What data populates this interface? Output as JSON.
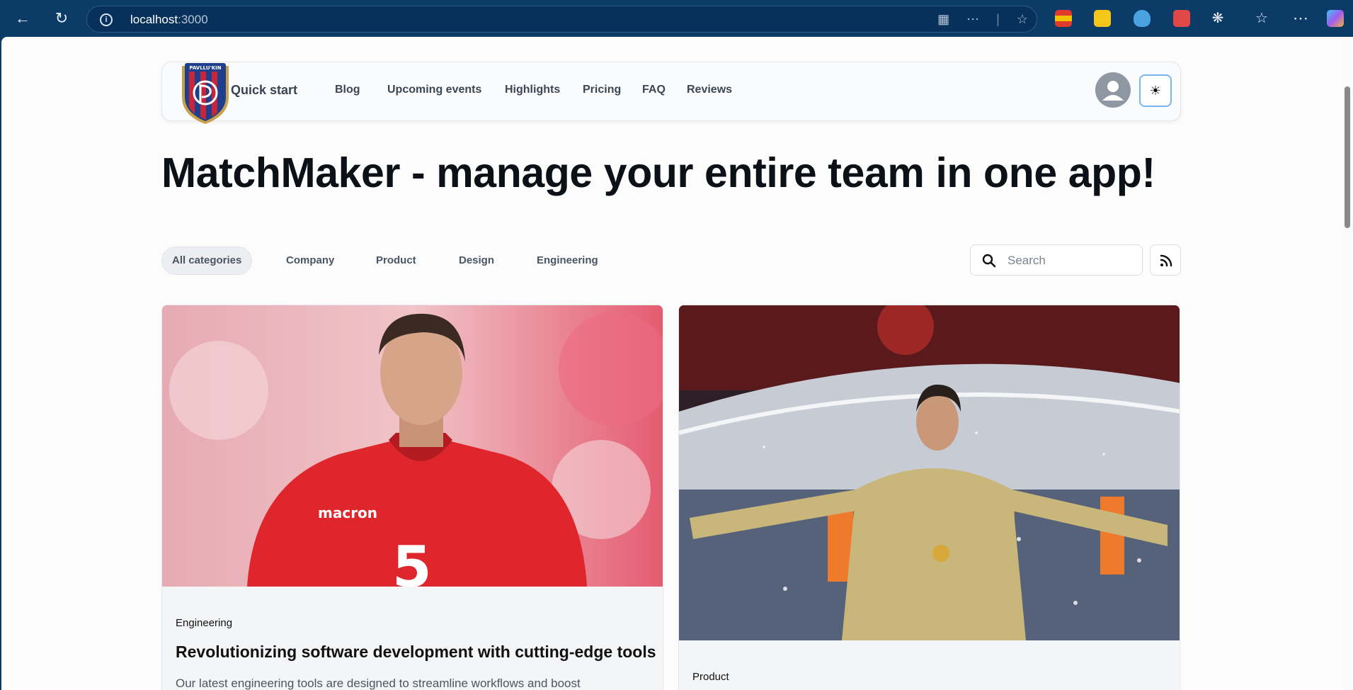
{
  "browser": {
    "url_host": "localhost",
    "url_port": ":3000"
  },
  "header": {
    "logo_text": "PAVLLU'KIN",
    "nav": [
      "Quick start",
      "Blog",
      "Upcoming events",
      "Highlights",
      "Pricing",
      "FAQ",
      "Reviews"
    ]
  },
  "hero": {
    "title": "MatchMaker - manage your entire team in one app!"
  },
  "filters": {
    "categories": [
      "All categories",
      "Company",
      "Product",
      "Design",
      "Engineering"
    ],
    "search_placeholder": "Search"
  },
  "cards": [
    {
      "category": "Engineering",
      "title": "Revolutionizing software development with cutting-edge tools",
      "excerpt": "Our latest engineering tools are designed to streamline workflows and boost",
      "image": "soccer-player-red-jersey"
    },
    {
      "category": "Product",
      "image": "goalkeeper-celebrating-stadium"
    }
  ],
  "colors": {
    "browser_chrome": "#0c3b68",
    "page_bg": "#fcfcfd",
    "active_chip": "#eceef2",
    "theme_focus": "#7cb6f2"
  }
}
